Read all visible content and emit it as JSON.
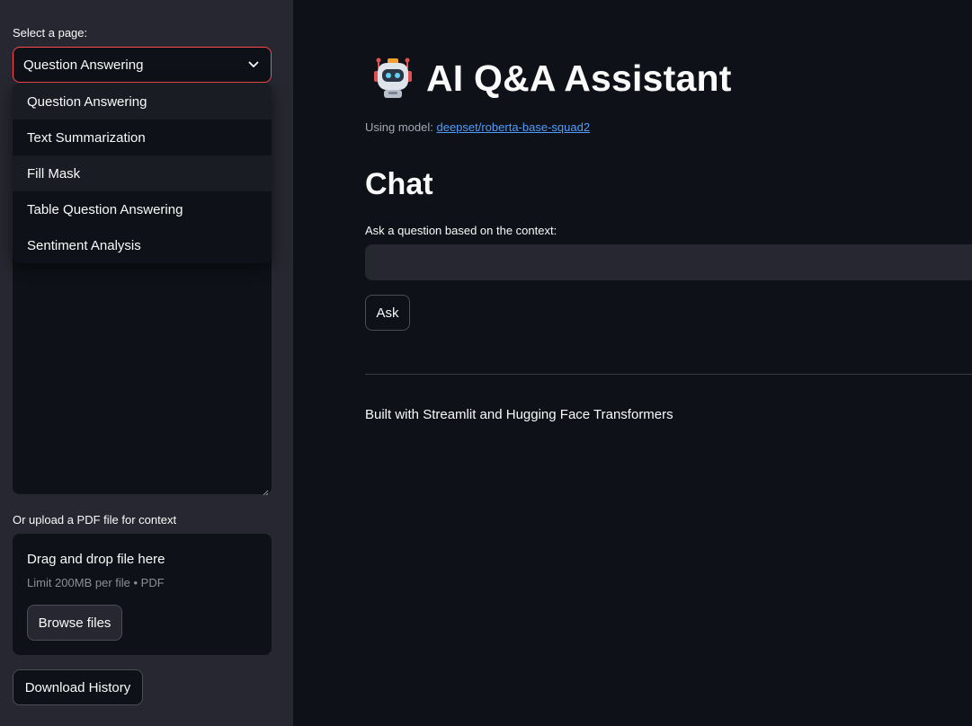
{
  "sidebar": {
    "select_label": "Select a page:",
    "selected_page": "Question Answering",
    "options": [
      "Question Answering",
      "Text Summarization",
      "Fill Mask",
      "Table Question Answering",
      "Sentiment Analysis"
    ],
    "upload_label": "Or upload a PDF file for context",
    "dropzone_title": "Drag and drop file here",
    "dropzone_limit": "Limit 200MB per file • PDF",
    "browse_button": "Browse files",
    "download_button": "Download History"
  },
  "main": {
    "title": "AI Q&A Assistant",
    "model_prefix": "Using model: ",
    "model_name": "deepset/roberta-base-squad2",
    "section_title": "Chat",
    "question_label": "Ask a question based on the context:",
    "question_value": "",
    "ask_button": "Ask",
    "footer": "Built with Streamlit and Hugging Face Transformers"
  },
  "colors": {
    "background": "#0e1117",
    "sidebar": "#262730",
    "accent": "#ff4b4b",
    "link": "#4f9dff"
  },
  "icons": {
    "select_chevron": "chevron-down-icon",
    "title_emoji": "robot-icon"
  }
}
